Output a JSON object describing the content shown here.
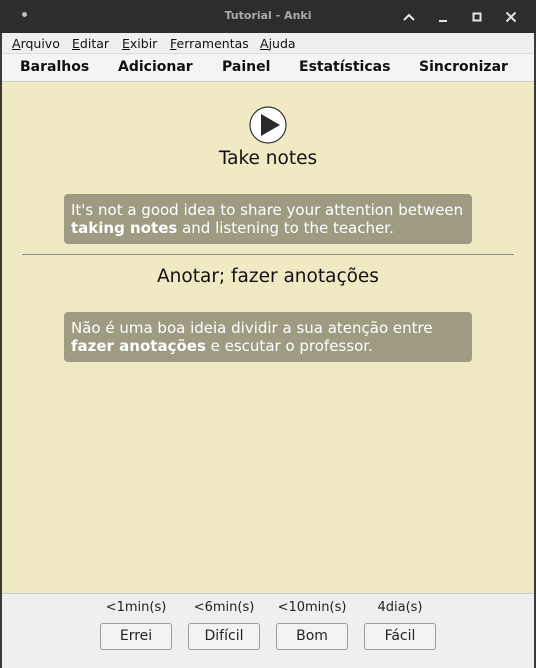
{
  "window": {
    "title": "Tutorial - Anki"
  },
  "menu": {
    "items": [
      {
        "first": "A",
        "rest": "rquivo"
      },
      {
        "first": "E",
        "rest": "ditar"
      },
      {
        "first": "E",
        "rest": "xibir"
      },
      {
        "first": "F",
        "rest": "erramentas"
      },
      {
        "first": "A",
        "rest": "juda"
      }
    ]
  },
  "toolbar": {
    "decks": "Baralhos",
    "add": "Adicionar",
    "browse": "Painel",
    "stats": "Estatísticas",
    "sync": "Sincronizar"
  },
  "card": {
    "front_word": "Take notes",
    "front_note": {
      "before": "It's not a good idea to share your attention between ",
      "bold": "taking notes",
      "after": " and listening to the teacher."
    },
    "back_word": "Anotar; fazer anotações",
    "back_note": {
      "before": "Não é uma boa ideia dividir a sua atenção entre ",
      "bold": "fazer anotações",
      "after": " e escutar o professor."
    }
  },
  "answers": [
    {
      "interval": "<1min(s)",
      "label": "Errei"
    },
    {
      "interval": "<6min(s)",
      "label": "Difícil"
    },
    {
      "interval": "<10min(s)",
      "label": "Bom"
    },
    {
      "interval": "4dia(s)",
      "label": "Fácil"
    }
  ],
  "icons": {
    "play": "play-audio-icon",
    "up": "chevron-up-icon",
    "minimize": "minimize-icon",
    "maximize": "maximize-icon",
    "close": "close-icon"
  },
  "colors": {
    "card_background": "#efe9c4",
    "note_background": "#9e9b82",
    "titlebar": "#2d2d2d"
  }
}
